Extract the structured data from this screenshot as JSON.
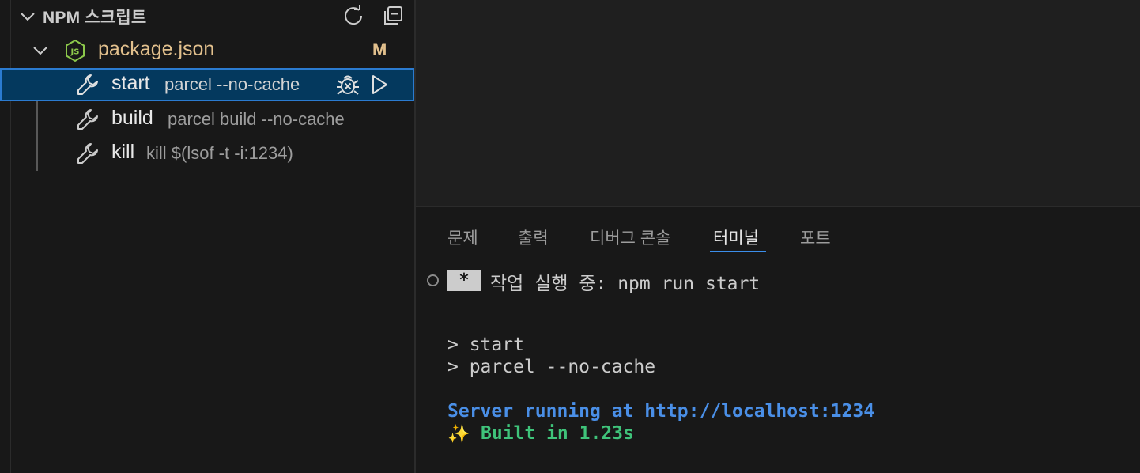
{
  "sidebar": {
    "section_title": "NPM 스크립트",
    "refresh_icon": "refresh-icon",
    "collapse_all_icon": "collapse-all-icon",
    "package": {
      "label": "package.json",
      "badge": "M",
      "icon": "nodejs-icon"
    },
    "scripts": [
      {
        "name": "start",
        "command": "parcel --no-cache",
        "selected": true
      },
      {
        "name": "build",
        "command": "parcel build --no-cache",
        "selected": false
      },
      {
        "name": "kill",
        "command": "kill $(lsof -t -i:1234)",
        "selected": false
      }
    ]
  },
  "panel": {
    "tabs": [
      {
        "label": "문제",
        "active": false
      },
      {
        "label": "출력",
        "active": false
      },
      {
        "label": "디버그 콘솔",
        "active": false
      },
      {
        "label": "터미널",
        "active": true
      },
      {
        "label": "포트",
        "active": false
      }
    ],
    "terminal": {
      "task_badge": "*",
      "task_line": "작업 실행 중: npm run start",
      "lines": [
        "> start",
        "> parcel --no-cache",
        "Server running at http://localhost:1234",
        "Built in 1.23s"
      ],
      "sparkle": "✨"
    }
  },
  "colors": {
    "accent": "#2b7bd0",
    "selected_bg": "#04395e",
    "modified": "#e2c08d",
    "server_text": "#4a8fe7",
    "success_text": "#3fc37a"
  }
}
